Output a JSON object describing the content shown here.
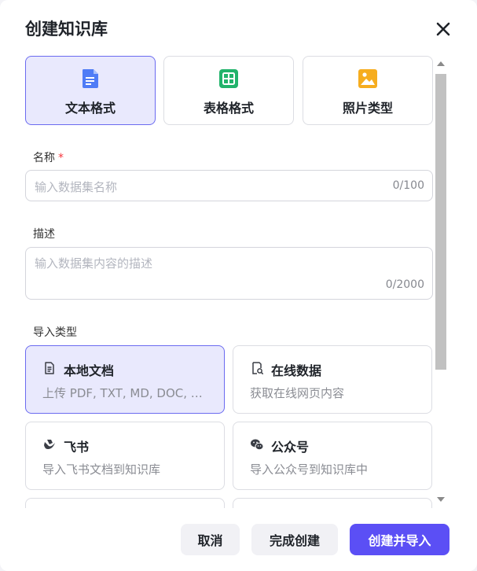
{
  "dialog": {
    "title": "创建知识库"
  },
  "format_types": [
    {
      "label": "文本格式",
      "icon": "document-icon",
      "selected": true
    },
    {
      "label": "表格格式",
      "icon": "table-icon",
      "selected": false
    },
    {
      "label": "照片类型",
      "icon": "image-icon",
      "selected": false
    }
  ],
  "name_field": {
    "label": "名称",
    "required_mark": "*",
    "placeholder": "输入数据集名称",
    "counter": "0/100"
  },
  "description_field": {
    "label": "描述",
    "placeholder": "输入数据集内容的描述",
    "counter": "0/2000"
  },
  "import_type": {
    "label": "导入类型",
    "options": [
      {
        "title": "本地文档",
        "description": "上传 PDF, TXT, MD, DOC, …",
        "icon": "file-icon",
        "selected": true
      },
      {
        "title": "在线数据",
        "description": "获取在线网页内容",
        "icon": "web-page-icon",
        "selected": false
      },
      {
        "title": "飞书",
        "description": "导入飞书文档到知识库",
        "icon": "feishu-icon",
        "selected": false
      },
      {
        "title": "公众号",
        "description": "导入公众号到知识库中",
        "icon": "wechat-icon",
        "selected": false
      }
    ]
  },
  "footer": {
    "cancel_label": "取消",
    "finish_label": "完成创建",
    "create_import_label": "创建并导入"
  },
  "colors": {
    "primary": "#5b4ff5",
    "selected_bg": "#e9e9fd",
    "selected_border": "#6b6bf0",
    "required": "#f5363d"
  }
}
